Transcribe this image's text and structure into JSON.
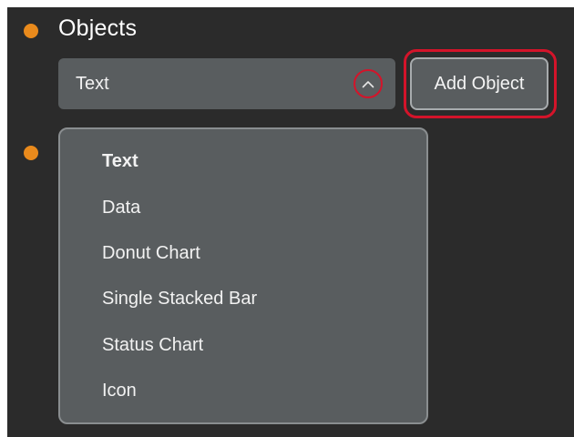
{
  "objects_section": {
    "title": "Objects",
    "select": {
      "value": "Text",
      "chevron_icon": "chevron-up-icon",
      "options": [
        "Text",
        "Data",
        "Donut Chart",
        "Single Stacked Bar",
        "Status Chart",
        "Icon"
      ]
    },
    "add_button_label": "Add Object"
  },
  "colors": {
    "panel_background": "#2b2b2b",
    "bullet": "#e98a1c",
    "control_background": "#595d5f",
    "highlight_ring": "#d4142a"
  }
}
